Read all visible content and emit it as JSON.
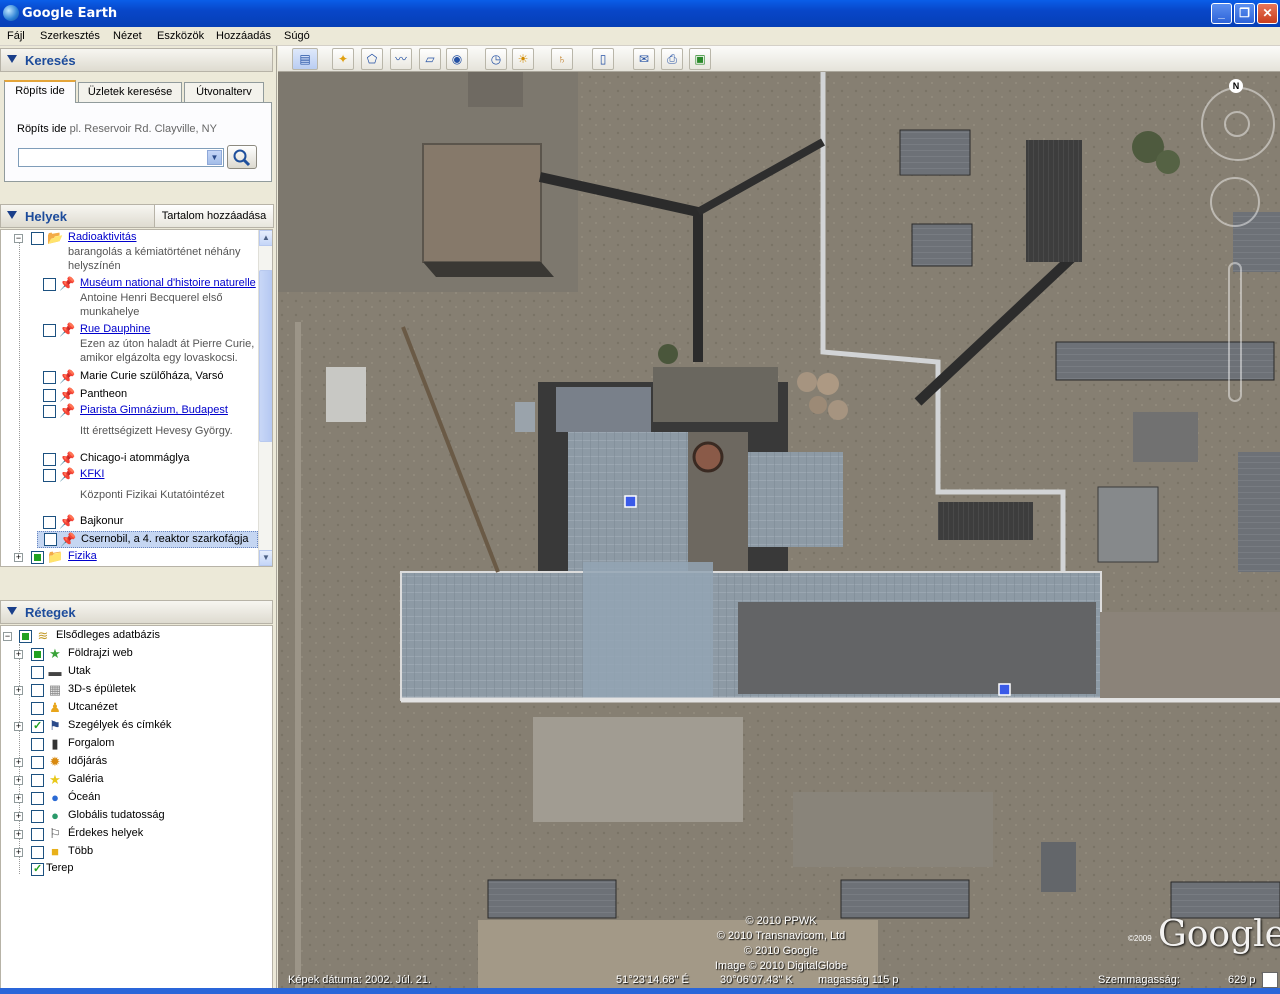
{
  "window": {
    "title": "Google Earth"
  },
  "menu": [
    "Fájl",
    "Szerkesztés",
    "Nézet",
    "Eszközök",
    "Hozzáadás",
    "Súgó"
  ],
  "search": {
    "header": "Keresés",
    "tabs": [
      "Röpíts ide",
      "Üzletek keresése",
      "Útvonalterv"
    ],
    "label": "Röpíts ide",
    "example": "pl. Reservoir Rd. Clayville, NY",
    "input_value": ""
  },
  "places": {
    "header": "Helyek",
    "add_content": "Tartalom hozzáadása",
    "items": [
      {
        "title": "Radioaktivitás",
        "link": true,
        "desc": "barangolás a kémiatörténet néhány helyszínén"
      },
      {
        "title": "Muséum national d'histoire naturelle",
        "link": true,
        "desc": "Antoine Henri Becquerel első munkahelye"
      },
      {
        "title": "Rue Dauphine",
        "link": true,
        "desc": "Ezen az úton haladt át Pierre Curie, amikor elgázolta egy lovaskocsi."
      },
      {
        "title": "Marie Curie szülőháza, Varsó",
        "link": false,
        "desc": ""
      },
      {
        "title": "Pantheon",
        "link": false,
        "desc": ""
      },
      {
        "title": "Piarista Gimnázium, Budapest",
        "link": true,
        "desc": "Itt érettségizett Hevesy György."
      },
      {
        "title": "Chicago-i atommáglya",
        "link": false,
        "desc": ""
      },
      {
        "title": "KFKI",
        "link": true,
        "desc": "Központi Fizikai Kutatóintézet"
      },
      {
        "title": "Bajkonur",
        "link": false,
        "desc": ""
      },
      {
        "title": "Csernobil, a 4. reaktor szarkofágja",
        "link": false,
        "desc": "",
        "selected": true
      },
      {
        "title": "Fizika",
        "link": true,
        "desc": ""
      }
    ]
  },
  "layers": {
    "header": "Rétegek",
    "items": [
      {
        "label": "Elsődleges adatbázis",
        "icon": "layers-icon"
      },
      {
        "label": "Földrajzi web",
        "icon": "star-icon"
      },
      {
        "label": "Utak",
        "icon": "road-icon"
      },
      {
        "label": "3D-s épületek",
        "icon": "building-icon"
      },
      {
        "label": "Utcanézet",
        "icon": "pegman-icon"
      },
      {
        "label": "Szegélyek és címkék",
        "icon": "flag-icon"
      },
      {
        "label": "Forgalom",
        "icon": "traffic-icon"
      },
      {
        "label": "Időjárás",
        "icon": "sun-icon"
      },
      {
        "label": "Galéria",
        "icon": "star-icon"
      },
      {
        "label": "Óceán",
        "icon": "globe-icon"
      },
      {
        "label": "Globális tudatosság",
        "icon": "globe-icon"
      },
      {
        "label": "Érdekes helyek",
        "icon": "flag-icon"
      },
      {
        "label": "Több",
        "icon": "box-icon"
      },
      {
        "label": "Terep",
        "icon": ""
      }
    ]
  },
  "attribution": [
    "© 2010 PPWK",
    "© 2010 Transnavicom, Ltd",
    "© 2010 Google",
    "Image © 2010 DigitalGlobe"
  ],
  "logo": {
    "text": "Google",
    "year": "©2009"
  },
  "compass": {
    "north": "N"
  },
  "status": {
    "date": "Képek dátuma: 2002. Júl. 21.",
    "lat": "51°23'14.68\" É",
    "lon": "30°06'07.43\" K",
    "elev": "magasság  115 p",
    "eye": "Szemmagasság:",
    "eye_value": "629 p"
  },
  "colors": {
    "title_bar": "#0846c8",
    "link": "#0000cc",
    "header_text": "#1c4b9b",
    "selection": "#c5d6f2"
  }
}
